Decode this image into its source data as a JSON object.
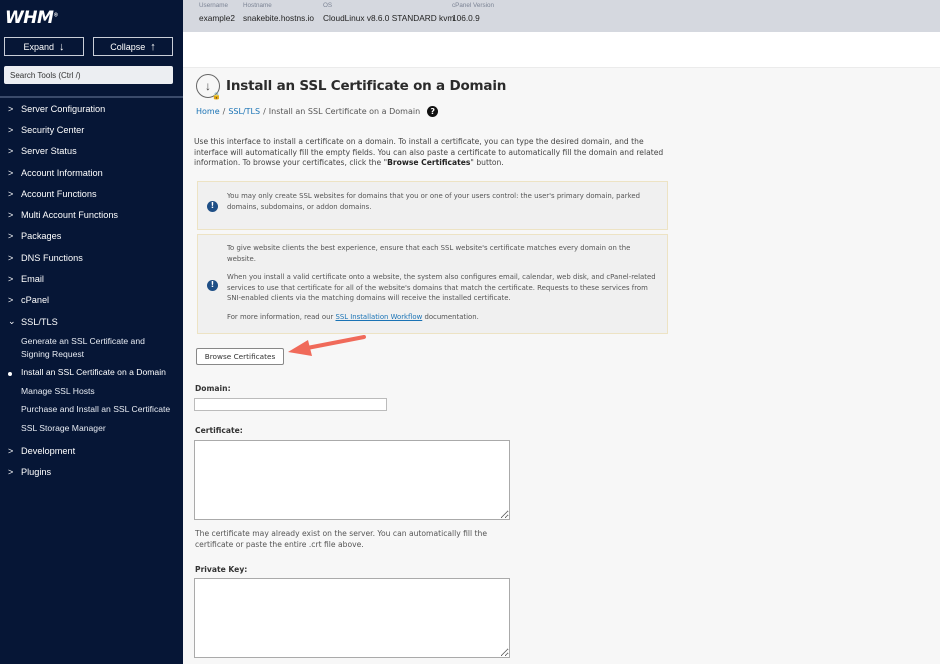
{
  "sidebar": {
    "logo": "WHM",
    "expand_label": "Expand",
    "collapse_label": "Collapse",
    "search_placeholder": "Search Tools (Ctrl /)",
    "items": [
      {
        "label": "Server Configuration"
      },
      {
        "label": "Security Center"
      },
      {
        "label": "Server Status"
      },
      {
        "label": "Account Information"
      },
      {
        "label": "Account Functions"
      },
      {
        "label": "Multi Account Functions"
      },
      {
        "label": "Packages"
      },
      {
        "label": "DNS Functions"
      },
      {
        "label": "Email"
      },
      {
        "label": "cPanel"
      },
      {
        "label": "SSL/TLS",
        "expanded": true
      },
      {
        "label": "Development"
      },
      {
        "label": "Plugins"
      }
    ],
    "ssl_subitems": [
      {
        "label": "Generate an SSL Certificate and Signing Request"
      },
      {
        "label": "Install an SSL Certificate on a Domain",
        "active": true
      },
      {
        "label": "Manage SSL Hosts"
      },
      {
        "label": "Purchase and Install an SSL Certificate"
      },
      {
        "label": "SSL Storage Manager"
      }
    ]
  },
  "topbar": {
    "username_label": "Username",
    "username": "example2",
    "hostname_label": "Hostname",
    "hostname": "snakebite.hostns.io",
    "os_label": "OS",
    "os": "CloudLinux v8.6.0 STANDARD kvm",
    "cpanel_version_label": "cPanel Version",
    "cpanel_version": "106.0.9"
  },
  "page": {
    "title": "Install an SSL Certificate on a Domain",
    "breadcrumb": [
      "Home",
      "SSL/TLS",
      "Install an SSL Certificate on a Domain"
    ],
    "intro_before": "Use this interface to install a certificate on a domain. To install a certificate, you can type the desired domain, and the interface will automatically fill the empty fields. You can also paste a certificate to automatically fill the domain and related information. To browse your certificates, click the \"",
    "intro_bold": "Browse Certificates",
    "intro_after": "\" button.",
    "alert1": "You may only create SSL websites for domains that you or one of your users control: the user's primary domain, parked domains, subdomains, or addon domains.",
    "alert2_p1": "To give website clients the best experience, ensure that each SSL website's certificate matches every domain on the website.",
    "alert2_p2": "When you install a valid certificate onto a website, the system also configures email, calendar, web disk, and cPanel-related services to use that certificate for all of the website's domains that match the certificate. Requests to these services from SNI-enabled clients via the matching domains will receive the installed certificate.",
    "alert2_p3_before": "For more information, read our ",
    "alert2_link": "SSL Installation Workflow",
    "alert2_p3_after": " documentation.",
    "browse_button": "Browse Certificates",
    "domain_label": "Domain:",
    "domain_value": "",
    "certificate_label": "Certificate:",
    "certificate_value": "",
    "certificate_help": "The certificate may already exist on the server. You can automatically fill the certificate or paste the entire .crt file above.",
    "private_key_label": "Private Key:",
    "private_key_value": ""
  },
  "colors": {
    "sidebar_bg": "#061636",
    "link": "#1a73b5",
    "info_icon": "#1f4f86",
    "annotation_arrow": "#f06a5a"
  }
}
